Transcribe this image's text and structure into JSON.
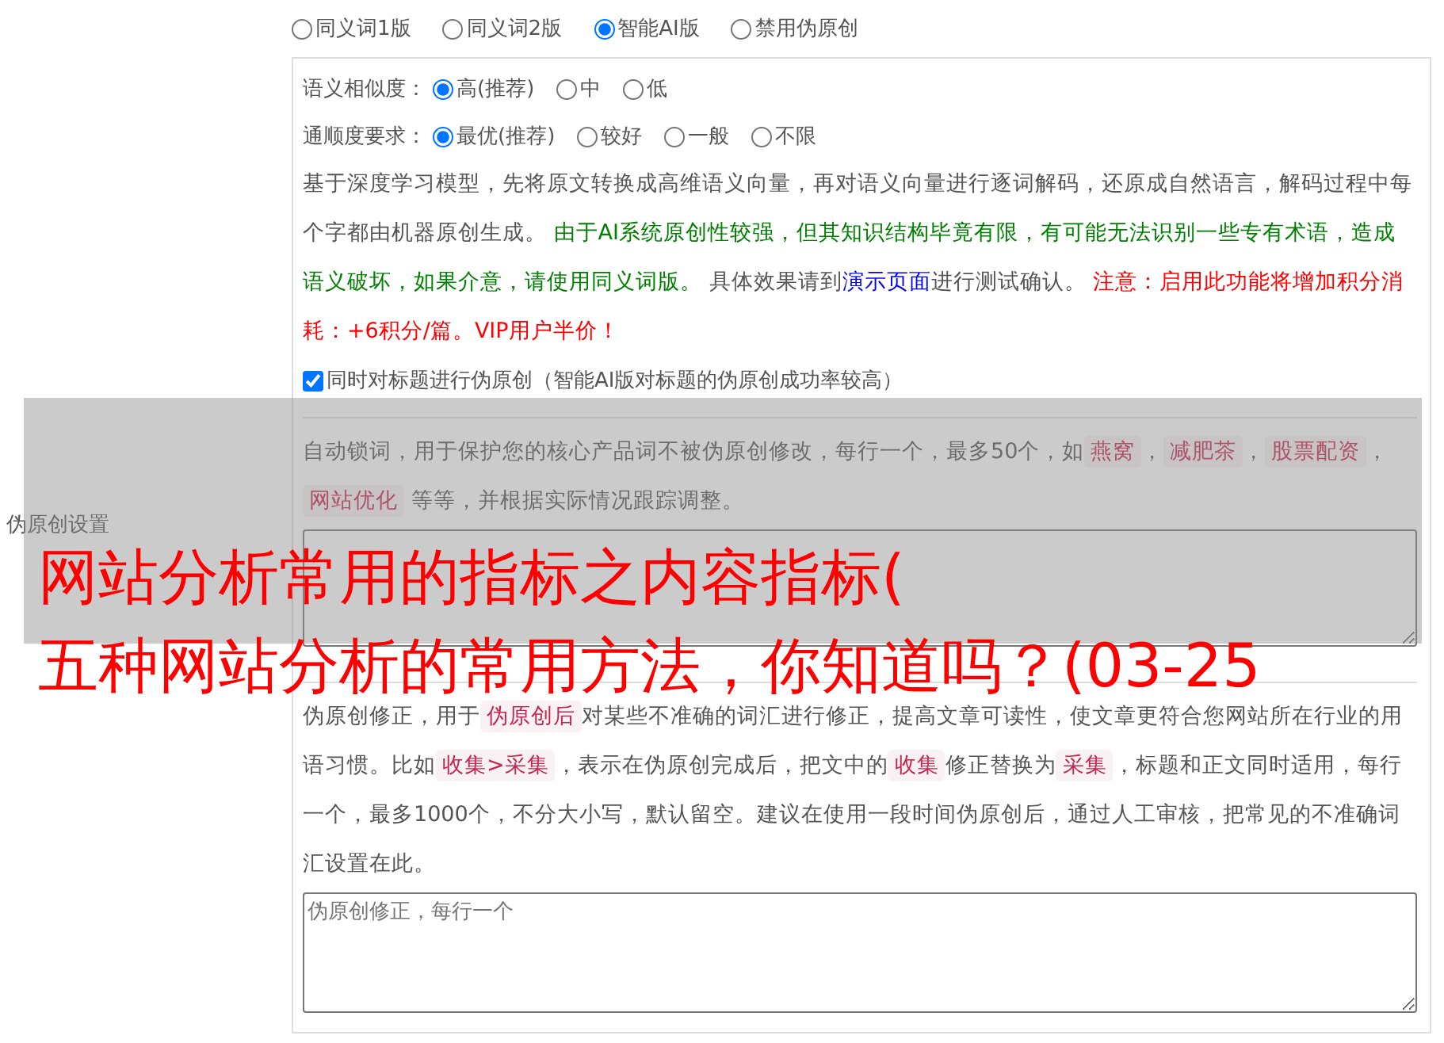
{
  "version_options": [
    {
      "label": "同义词1版",
      "selected": false
    },
    {
      "label": "同义词2版",
      "selected": false
    },
    {
      "label": "智能AI版",
      "selected": true
    },
    {
      "label": "禁用伪原创",
      "selected": false
    }
  ],
  "similarity": {
    "label": "语义相似度：",
    "options": [
      {
        "label": "高(推荐)",
        "selected": true
      },
      {
        "label": "中",
        "selected": false
      },
      {
        "label": "低",
        "selected": false
      }
    ]
  },
  "fluency": {
    "label": "通顺度要求：",
    "options": [
      {
        "label": "最优(推荐)",
        "selected": true
      },
      {
        "label": "较好",
        "selected": false
      },
      {
        "label": "一般",
        "selected": false
      },
      {
        "label": "不限",
        "selected": false
      }
    ]
  },
  "ai_description": [
    {
      "kind": "text",
      "text": "基于深度学习模型，先将原文转换成高维语义向量，再对语义向量进行逐词解码，还原成自然语言，解码过程中每个字都由机器原创生成。 "
    },
    {
      "kind": "green",
      "text": "由于AI系统原创性较强，但其知识结构毕竟有限，有可能无法识别一些专有术语，造成语义破坏，如果介意，请使用同义词版。"
    },
    {
      "kind": "text",
      "text": " 具体效果请到"
    },
    {
      "kind": "link",
      "text": "演示页面"
    },
    {
      "kind": "text",
      "text": "进行测试确认。 "
    },
    {
      "kind": "red",
      "text": "注意：启用此功能将增加积分消耗：+6积分/篇。VIP用户半价！"
    }
  ],
  "title_checkbox": {
    "label": "同时对标题进行伪原创（智能AI版对标题的伪原创成功率较高）",
    "checked": true
  },
  "section_label": "伪原创设置",
  "lock_words": {
    "description": [
      {
        "kind": "text",
        "text": "自动锁词，用于保护您的核心产品词不被伪原创修改，每行一个，最多50个，如"
      },
      {
        "kind": "code",
        "text": "燕窝"
      },
      {
        "kind": "text",
        "text": "，"
      },
      {
        "kind": "code",
        "text": "减肥茶"
      },
      {
        "kind": "text",
        "text": "，"
      },
      {
        "kind": "code",
        "text": "股票配资"
      },
      {
        "kind": "text",
        "text": "，"
      },
      {
        "kind": "code",
        "text": "网站优化"
      },
      {
        "kind": "text",
        "text": " 等等，并根据实际情况跟踪调整。"
      }
    ]
  },
  "correction": {
    "description": [
      {
        "kind": "text",
        "text": "伪原创修正，用于"
      },
      {
        "kind": "code",
        "text": "伪原创后"
      },
      {
        "kind": "text",
        "text": "对某些不准确的词汇进行修正，提高文章可读性，使文章更符合您网站所在行业的用语习惯。比如"
      },
      {
        "kind": "code",
        "text": "收集>采集"
      },
      {
        "kind": "text",
        "text": "，表示在伪原创完成后，把文中的"
      },
      {
        "kind": "code",
        "text": "收集"
      },
      {
        "kind": "text",
        "text": "修正替换为"
      },
      {
        "kind": "code",
        "text": "采集"
      },
      {
        "kind": "text",
        "text": "，标题和正文同时适用，每行一个，最多1000个，不分大小写，默认留空。建议在使用一段时间伪原创后，通过人工审核，把常见的不准确词汇设置在此。"
      }
    ],
    "placeholder": "伪原创修正，每行一个"
  },
  "overlay_banner": {
    "lines": [
      "网站分析常用的指标之内容指标(",
      "五种网站分析的常用方法，你知道吗？(03-25"
    ]
  }
}
